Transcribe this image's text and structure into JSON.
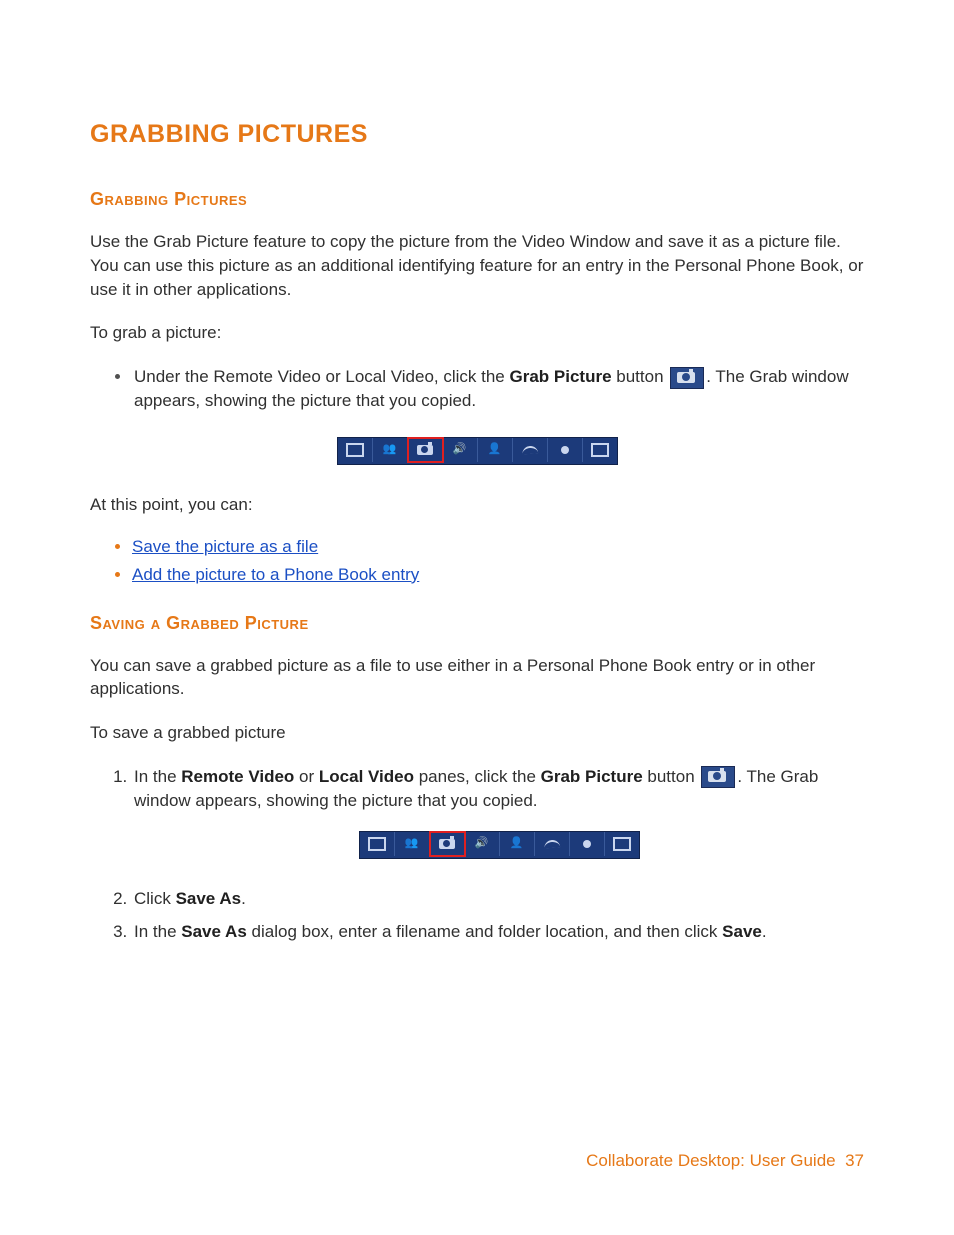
{
  "title": "GRABBING PICTURES",
  "section1": {
    "heading": "Grabbing Pictures",
    "p1": "Use the Grab Picture feature to copy the picture from the Video Window and save it as a picture file. You can use this picture as an additional identifying feature for an entry in the Personal Phone Book, or use it in other applications.",
    "p2": "To grab a picture:",
    "bullet_pre": "Under the Remote Video or Local Video, click the ",
    "bullet_bold": "Grab Picture",
    "bullet_mid": " button ",
    "bullet_post": ". The Grab window appears, showing the picture that you copied.",
    "p3": "At this point, you can:",
    "link1": "Save the picture as a file",
    "link2": "Add the picture to a Phone Book entry"
  },
  "section2": {
    "heading": "Saving a Grabbed Picture",
    "p1": "You can save a grabbed picture as a file to use either in a Personal Phone Book entry or in other applications.",
    "p2": "To save a grabbed picture",
    "step1_a": "In the ",
    "step1_b1": "Remote Video",
    "step1_c": " or ",
    "step1_b2": "Local Video",
    "step1_d": " panes, click the ",
    "step1_b3": "Grab Picture",
    "step1_e": " button ",
    "step1_f": ". The Grab window appears, showing the picture that you copied.",
    "step2_a": "Click ",
    "step2_b": "Save As",
    "step2_c": ".",
    "step3_a": "In the ",
    "step3_b1": "Save As",
    "step3_c": " dialog box, enter a filename and folder location, and then click ",
    "step3_b2": "Save",
    "step3_d": "."
  },
  "footer": {
    "label": "Collaborate Desktop: User Guide",
    "page": "37"
  },
  "toolbar_icons": [
    "layout-icon",
    "group-icon",
    "camera-icon",
    "audio-icon",
    "bookmark-icon",
    "wave-icon",
    "record-icon",
    "screen-icon"
  ]
}
